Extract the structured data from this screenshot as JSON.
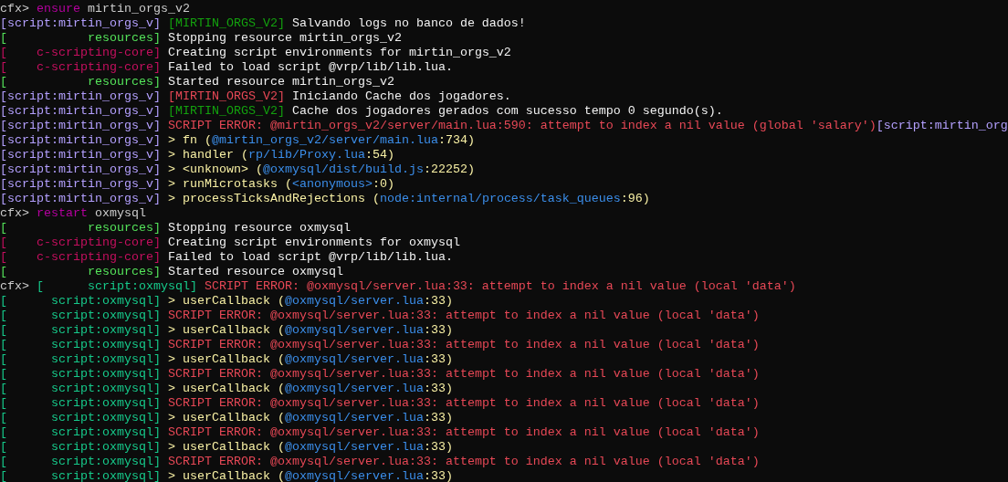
{
  "console": {
    "lines": [
      [
        [
          {
            "text": "cfx>",
            "color": "#cccccc"
          }
        ],
        [
          {
            "text": "ensure",
            "color": "#b4009e"
          }
        ],
        [
          {
            "text": "mirtin_orgs_v2",
            "color": "#cccccc"
          }
        ]
      ],
      [
        [
          {
            "text": "[script:mirtin_orgs_v]",
            "color": "#b4a0ff"
          }
        ],
        [
          {
            "text": "[MIRTIN_ORGS_V2]",
            "color": "#13a10e"
          }
        ],
        [
          {
            "text": "Salvando logs no banco de dados!",
            "color": "#f2f2f2"
          }
        ]
      ],
      [
        [
          {
            "text": "[           resources]",
            "color": "#54e35a"
          }
        ],
        [
          {
            "text": "Stopping resource mirtin_orgs_v2",
            "color": "#f2f2f2"
          }
        ]
      ],
      [
        [
          {
            "text": "[    c-scripting-core]",
            "color": "#c50f5f"
          }
        ],
        [
          {
            "text": "Creating script environments for mirtin_orgs_v2",
            "color": "#f2f2f2"
          }
        ]
      ],
      [
        [
          {
            "text": "[    c-scripting-core]",
            "color": "#c50f5f"
          }
        ],
        [
          {
            "text": "Failed to load script @vrp/lib/lib.lua.",
            "color": "#f2f2f2"
          }
        ]
      ],
      [
        [
          {
            "text": "[           resources]",
            "color": "#54e35a"
          }
        ],
        [
          {
            "text": "Started resource mirtin_orgs_v2",
            "color": "#f2f2f2"
          }
        ]
      ],
      [
        [
          {
            "text": "[script:mirtin_orgs_v]",
            "color": "#b4a0ff"
          }
        ],
        [
          {
            "text": "[MIRTIN_ORGS_V2]",
            "color": "#e74856"
          }
        ],
        [
          {
            "text": "Iniciando Cache dos jogadores.",
            "color": "#f2f2f2"
          }
        ]
      ],
      [
        [
          {
            "text": "[script:mirtin_orgs_v]",
            "color": "#b4a0ff"
          }
        ],
        [
          {
            "text": "[MIRTIN_ORGS_V2]",
            "color": "#13a10e"
          }
        ],
        [
          {
            "text": "Cache dos jogadores gerados com sucesso tempo 0 segundo(s).",
            "color": "#f2f2f2"
          }
        ]
      ],
      [
        [
          {
            "text": "[script:mirtin_orgs_v]",
            "color": "#b4a0ff"
          }
        ],
        [
          {
            "text": "SCRIPT ERROR: @mirtin_orgs_v2/server/main.lua:590: attempt to index a nil value (global 'salary')",
            "color": "#e74856"
          },
          {
            "text": "[script:mirtin_org",
            "color": "#b4a0ff"
          }
        ]
      ],
      [
        [
          {
            "text": "[script:mirtin_orgs_v]",
            "color": "#b4a0ff"
          }
        ],
        [
          {
            "text": "> fn (",
            "color": "#f9f1a5"
          },
          {
            "text": "@mirtin_orgs_v2/server/main.lua",
            "color": "#3b8eea"
          },
          {
            "text": ":734)",
            "color": "#f9f1a5"
          }
        ]
      ],
      [
        [
          {
            "text": "[script:mirtin_orgs_v]",
            "color": "#b4a0ff"
          }
        ],
        [
          {
            "text": "> handler (",
            "color": "#f9f1a5"
          },
          {
            "text": "rp/lib/Proxy.lua",
            "color": "#3b8eea"
          },
          {
            "text": ":54)",
            "color": "#f9f1a5"
          }
        ]
      ],
      [
        [
          {
            "text": "[script:mirtin_orgs_v]",
            "color": "#b4a0ff"
          }
        ],
        [
          {
            "text": "> <unknown> (",
            "color": "#f9f1a5"
          },
          {
            "text": "@oxmysql/dist/build.js",
            "color": "#3b8eea"
          },
          {
            "text": ":22252)",
            "color": "#f9f1a5"
          }
        ]
      ],
      [
        [
          {
            "text": "[script:mirtin_orgs_v]",
            "color": "#b4a0ff"
          }
        ],
        [
          {
            "text": "> runMicrotasks (",
            "color": "#f9f1a5"
          },
          {
            "text": "<anonymous>",
            "color": "#3b8eea"
          },
          {
            "text": ":0)",
            "color": "#f9f1a5"
          }
        ]
      ],
      [
        [
          {
            "text": "[script:mirtin_orgs_v]",
            "color": "#b4a0ff"
          }
        ],
        [
          {
            "text": "> processTicksAndRejections (",
            "color": "#f9f1a5"
          },
          {
            "text": "node:internal/process/task_queues",
            "color": "#3b8eea"
          },
          {
            "text": ":96)",
            "color": "#f9f1a5"
          }
        ]
      ],
      [
        [
          {
            "text": "cfx>",
            "color": "#cccccc"
          }
        ],
        [
          {
            "text": "restart",
            "color": "#b4009e"
          }
        ],
        [
          {
            "text": "oxmysql",
            "color": "#cccccc"
          }
        ]
      ],
      [
        [
          {
            "text": "[           resources]",
            "color": "#54e35a"
          }
        ],
        [
          {
            "text": "Stopping resource oxmysql",
            "color": "#f2f2f2"
          }
        ]
      ],
      [
        [
          {
            "text": "[    c-scripting-core]",
            "color": "#c50f5f"
          }
        ],
        [
          {
            "text": "Creating script environments for oxmysql",
            "color": "#f2f2f2"
          }
        ]
      ],
      [
        [
          {
            "text": "[    c-scripting-core]",
            "color": "#c50f5f"
          }
        ],
        [
          {
            "text": "Failed to load script @vrp/lib/lib.lua.",
            "color": "#f2f2f2"
          }
        ]
      ],
      [
        [
          {
            "text": "[           resources]",
            "color": "#54e35a"
          }
        ],
        [
          {
            "text": "Started resource oxmysql",
            "color": "#f2f2f2"
          }
        ]
      ],
      [
        [
          {
            "text": "cfx>",
            "color": "#cccccc"
          }
        ],
        [
          {
            "text": "[      script:oxmysql]",
            "color": "#16c98a"
          }
        ],
        [
          {
            "text": "SCRIPT ERROR: @oxmysql/server.lua:33: attempt to index a nil value (local 'data')",
            "color": "#e74856"
          }
        ]
      ],
      [
        [
          {
            "text": "[      script:oxmysql]",
            "color": "#16c98a"
          }
        ],
        [
          {
            "text": "> userCallback (",
            "color": "#f9f1a5"
          },
          {
            "text": "@oxmysql/server.lua",
            "color": "#3b8eea"
          },
          {
            "text": ":33)",
            "color": "#f9f1a5"
          }
        ]
      ],
      [
        [
          {
            "text": "[      script:oxmysql]",
            "color": "#16c98a"
          }
        ],
        [
          {
            "text": "SCRIPT ERROR: @oxmysql/server.lua:33: attempt to index a nil value (local 'data')",
            "color": "#e74856"
          }
        ]
      ],
      [
        [
          {
            "text": "[      script:oxmysql]",
            "color": "#16c98a"
          }
        ],
        [
          {
            "text": "> userCallback (",
            "color": "#f9f1a5"
          },
          {
            "text": "@oxmysql/server.lua",
            "color": "#3b8eea"
          },
          {
            "text": ":33)",
            "color": "#f9f1a5"
          }
        ]
      ],
      [
        [
          {
            "text": "[      script:oxmysql]",
            "color": "#16c98a"
          }
        ],
        [
          {
            "text": "SCRIPT ERROR: @oxmysql/server.lua:33: attempt to index a nil value (local 'data')",
            "color": "#e74856"
          }
        ]
      ],
      [
        [
          {
            "text": "[      script:oxmysql]",
            "color": "#16c98a"
          }
        ],
        [
          {
            "text": "> userCallback (",
            "color": "#f9f1a5"
          },
          {
            "text": "@oxmysql/server.lua",
            "color": "#3b8eea"
          },
          {
            "text": ":33)",
            "color": "#f9f1a5"
          }
        ]
      ],
      [
        [
          {
            "text": "[      script:oxmysql]",
            "color": "#16c98a"
          }
        ],
        [
          {
            "text": "SCRIPT ERROR: @oxmysql/server.lua:33: attempt to index a nil value (local 'data')",
            "color": "#e74856"
          }
        ]
      ],
      [
        [
          {
            "text": "[      script:oxmysql]",
            "color": "#16c98a"
          }
        ],
        [
          {
            "text": "> userCallback (",
            "color": "#f9f1a5"
          },
          {
            "text": "@oxmysql/server.lua",
            "color": "#3b8eea"
          },
          {
            "text": ":33)",
            "color": "#f9f1a5"
          }
        ]
      ],
      [
        [
          {
            "text": "[      script:oxmysql]",
            "color": "#16c98a"
          }
        ],
        [
          {
            "text": "SCRIPT ERROR: @oxmysql/server.lua:33: attempt to index a nil value (local 'data')",
            "color": "#e74856"
          }
        ]
      ],
      [
        [
          {
            "text": "[      script:oxmysql]",
            "color": "#16c98a"
          }
        ],
        [
          {
            "text": "> userCallback (",
            "color": "#f9f1a5"
          },
          {
            "text": "@oxmysql/server.lua",
            "color": "#3b8eea"
          },
          {
            "text": ":33)",
            "color": "#f9f1a5"
          }
        ]
      ],
      [
        [
          {
            "text": "[      script:oxmysql]",
            "color": "#16c98a"
          }
        ],
        [
          {
            "text": "SCRIPT ERROR: @oxmysql/server.lua:33: attempt to index a nil value (local 'data')",
            "color": "#e74856"
          }
        ]
      ],
      [
        [
          {
            "text": "[      script:oxmysql]",
            "color": "#16c98a"
          }
        ],
        [
          {
            "text": "> userCallback (",
            "color": "#f9f1a5"
          },
          {
            "text": "@oxmysql/server.lua",
            "color": "#3b8eea"
          },
          {
            "text": ":33)",
            "color": "#f9f1a5"
          }
        ]
      ],
      [
        [
          {
            "text": "[      script:oxmysql]",
            "color": "#16c98a"
          }
        ],
        [
          {
            "text": "SCRIPT ERROR: @oxmysql/server.lua:33: attempt to index a nil value (local 'data')",
            "color": "#e74856"
          }
        ]
      ],
      [
        [
          {
            "text": "[      script:oxmysql]",
            "color": "#16c98a"
          }
        ],
        [
          {
            "text": "> userCallback (",
            "color": "#f9f1a5"
          },
          {
            "text": "@oxmysql/server.lua",
            "color": "#3b8eea"
          },
          {
            "text": ":33)",
            "color": "#f9f1a5"
          }
        ]
      ]
    ]
  }
}
